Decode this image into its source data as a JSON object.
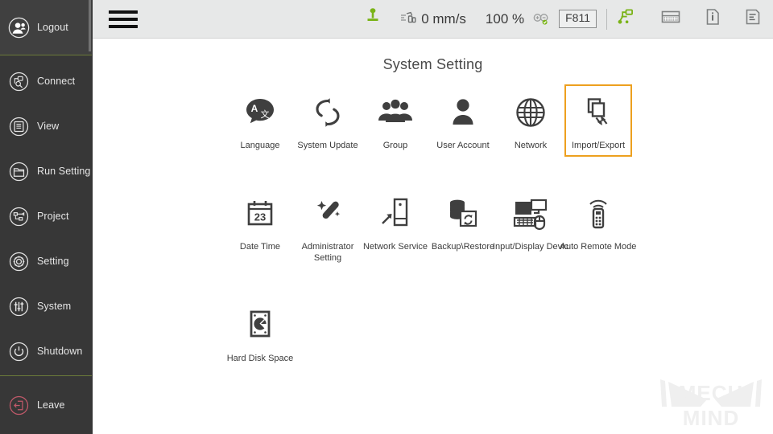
{
  "sidebar": {
    "logout": {
      "label": "Logout",
      "icon": "user-logout-icon"
    },
    "items": [
      {
        "label": "Connect",
        "icon": "connect-icon"
      },
      {
        "label": "View",
        "icon": "view-icon"
      },
      {
        "label": "Run Setting",
        "icon": "run-setting-icon"
      },
      {
        "label": "Project",
        "icon": "project-icon"
      },
      {
        "label": "Setting",
        "icon": "setting-gear-icon"
      },
      {
        "label": "System",
        "icon": "system-sliders-icon"
      },
      {
        "label": "Shutdown",
        "icon": "shutdown-power-icon"
      }
    ],
    "leave": {
      "label": "Leave",
      "icon": "leave-exit-icon",
      "color": "#c1596a"
    },
    "divider_color": "#6b7a3a",
    "background": "#373737"
  },
  "toolbar": {
    "menu_button": "hamburger-menu",
    "tool_icon": "tool-pin-icon",
    "speed_icon": "speed-icon",
    "speed_value": "0 mm/s",
    "zoom_value": "100 %",
    "zoom_icon": "zoom-in-out-icon",
    "frame_label": "F811",
    "robot_icon": "robot-link-icon",
    "keyboard_icon": "keyboard-icon",
    "info_icon": "info-document-icon",
    "log_icon": "log-list-icon",
    "accent_green": "#7ab317",
    "background": "#e7e8e8"
  },
  "main": {
    "title": "System Setting",
    "selected_color": "#eda01f",
    "rows": [
      [
        {
          "label": "Language",
          "icon": "language-translate-icon",
          "selected": false
        },
        {
          "label": "System Update",
          "icon": "system-update-icon",
          "selected": false
        },
        {
          "label": "Group",
          "icon": "group-users-icon",
          "selected": false
        },
        {
          "label": "User Account",
          "icon": "user-account-icon",
          "selected": false
        },
        {
          "label": "Network",
          "icon": "network-globe-icon",
          "selected": false
        },
        {
          "label": "Import/Export",
          "icon": "import-export-icon",
          "selected": true
        }
      ],
      [
        {
          "label": "Date Time",
          "icon": "calendar-icon",
          "selected": false
        },
        {
          "label": "Administrator Setting",
          "icon": "magic-wand-icon",
          "selected": false
        },
        {
          "label": "Network Service",
          "icon": "network-service-icon",
          "selected": false
        },
        {
          "label": "Backup\\Restore",
          "icon": "backup-restore-icon",
          "selected": false
        },
        {
          "label": "Input/Display Devic",
          "icon": "input-display-icon",
          "selected": false
        },
        {
          "label": "Auto Remote Mode",
          "icon": "remote-control-icon",
          "selected": false
        }
      ],
      [
        {
          "label": "Hard Disk Space",
          "icon": "hard-disk-icon",
          "selected": false
        }
      ]
    ]
  },
  "watermark": {
    "text": "MECH MIND",
    "icon": "mech-mind-camera-logo"
  }
}
